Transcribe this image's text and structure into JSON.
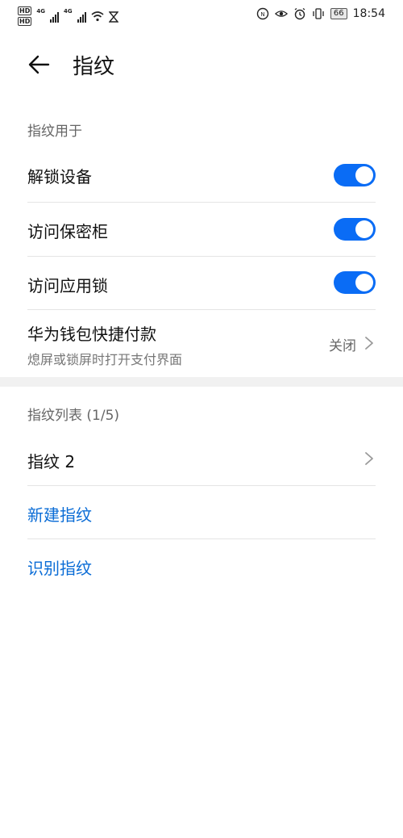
{
  "status_bar": {
    "hd1": "HD",
    "hd2": "HD",
    "net1": "4G",
    "net2": "4G",
    "battery": "66",
    "time": "18:54",
    "icons": [
      "nfc-icon",
      "eye-icon",
      "alarm-icon",
      "vibrate-icon",
      "battery-icon"
    ]
  },
  "header": {
    "title": "指纹",
    "back_icon": "arrow-left-icon"
  },
  "usage_section": {
    "label": "指纹用于",
    "items": [
      {
        "label": "解锁设备",
        "enabled": true
      },
      {
        "label": "访问保密柜",
        "enabled": true
      },
      {
        "label": "访问应用锁",
        "enabled": true
      }
    ],
    "wallet": {
      "label": "华为钱包快捷付款",
      "subtitle": "熄屏或锁屏时打开支付界面",
      "value": "关闭"
    }
  },
  "list_section": {
    "label": "指纹列表 (1/5)",
    "fingerprint": "指纹 2",
    "new_label": "新建指纹",
    "identify_label": "识别指纹"
  },
  "colors": {
    "accent": "#0a6cf5",
    "link": "#0a6cd6"
  }
}
